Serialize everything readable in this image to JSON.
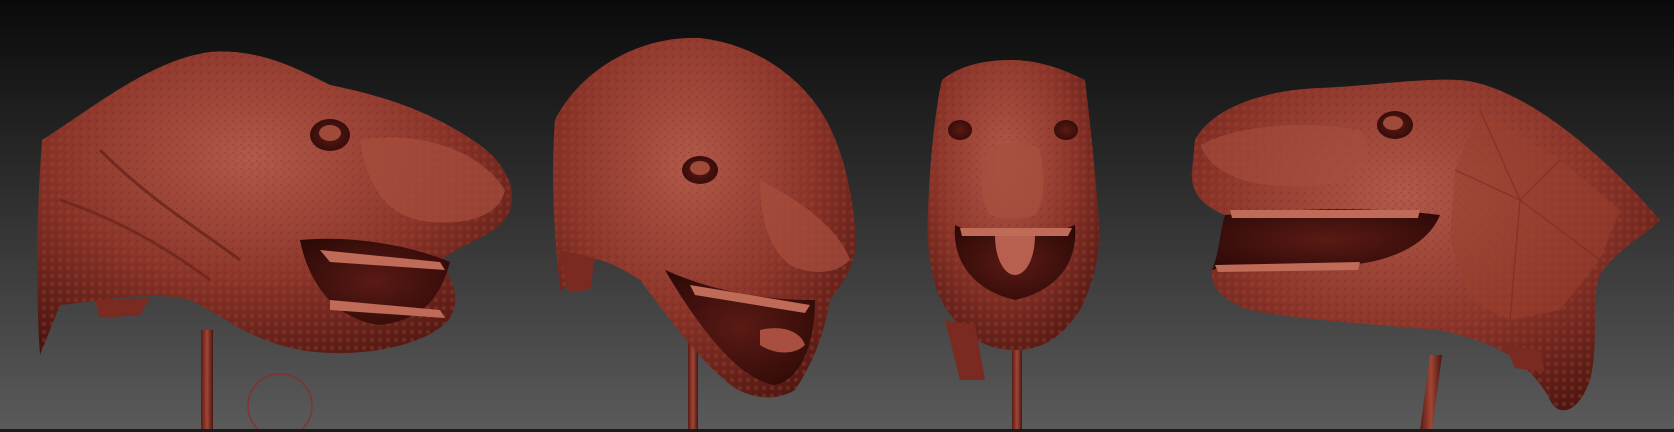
{
  "viewport": {
    "name": "3d-viewport",
    "background_top": "#0a0a0a",
    "background_bottom": "#5b5b5b",
    "material_color": "#8a3328",
    "material_highlight": "#b75a48",
    "material_shadow": "#4a1510"
  },
  "models": [
    {
      "name": "trex-head-three-quarter-right",
      "view": "three-quarter"
    },
    {
      "name": "trex-head-front-three-quarter",
      "view": "front-three-quarter"
    },
    {
      "name": "trex-head-front",
      "view": "front"
    },
    {
      "name": "trex-head-side-left",
      "view": "side"
    }
  ],
  "gizmo": {
    "name": "brush-cursor-circle",
    "color": "#8a2a2a"
  }
}
